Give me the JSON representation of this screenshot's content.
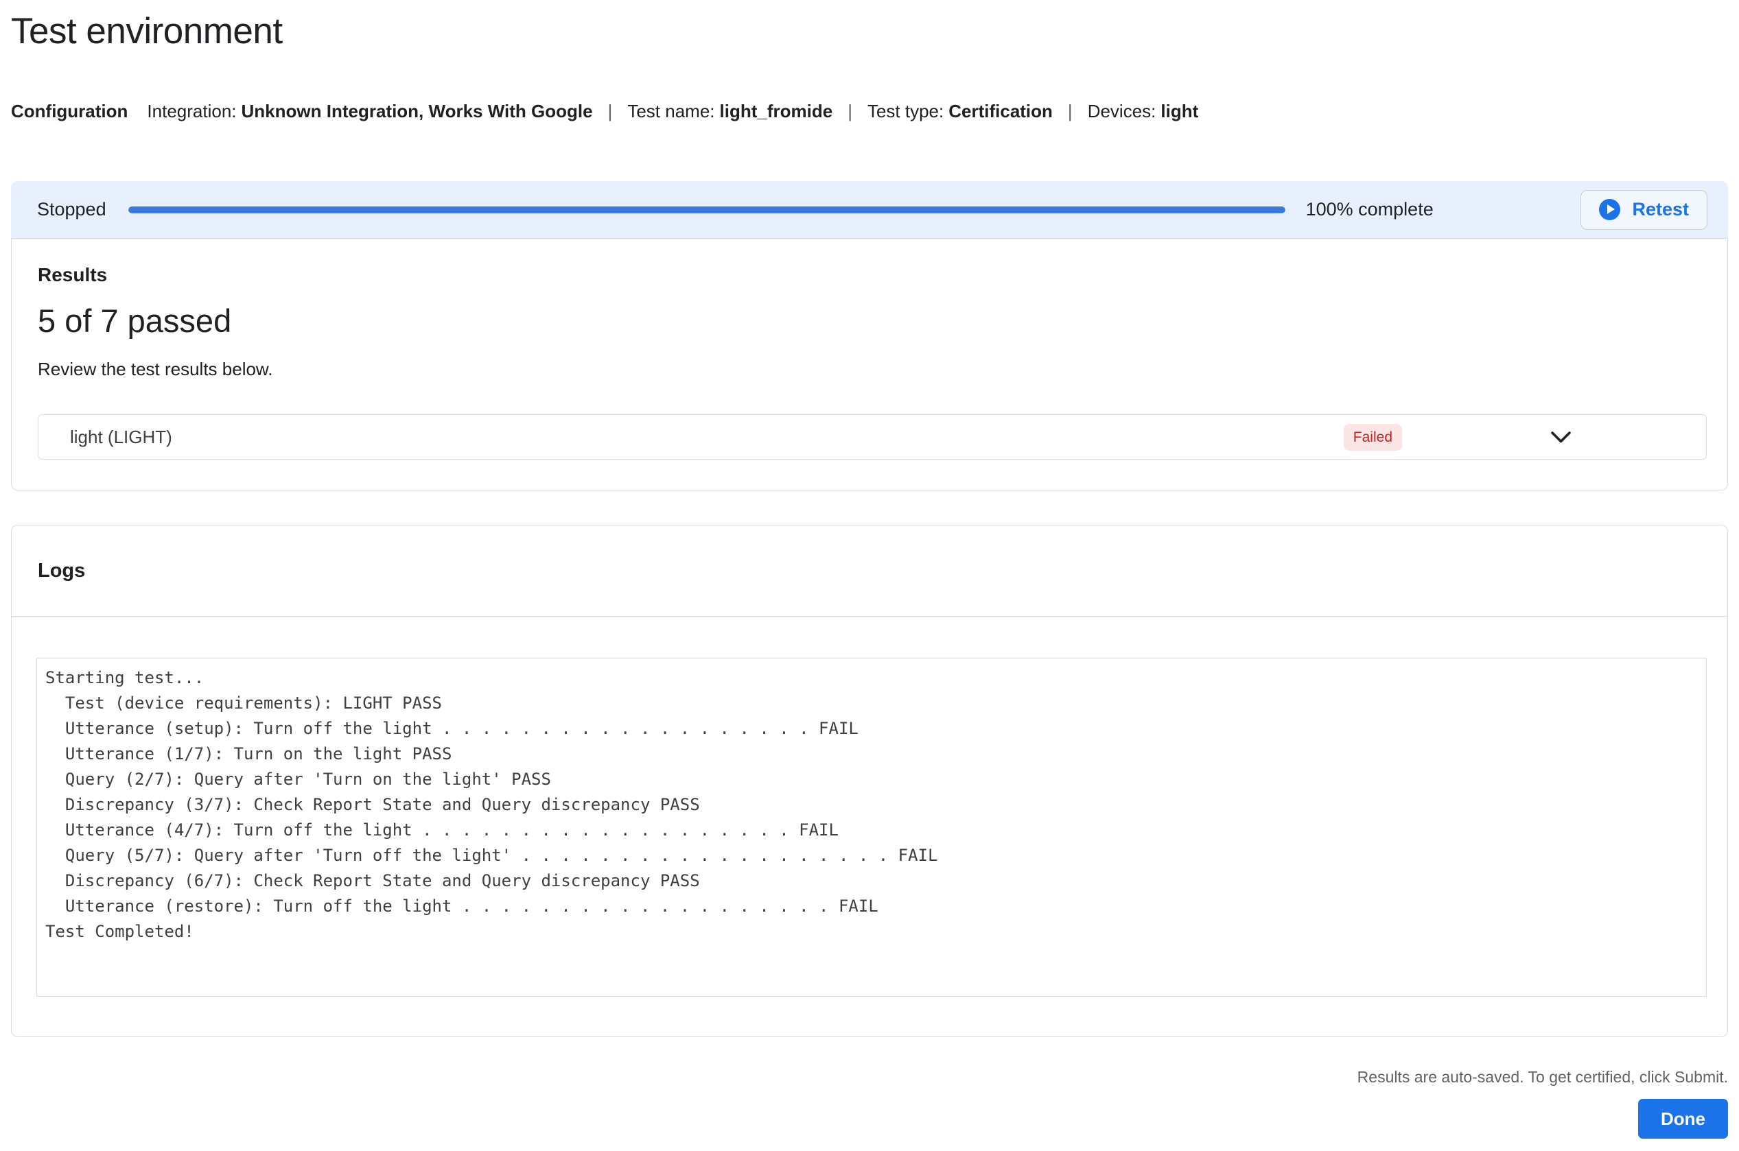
{
  "page": {
    "title": "Test environment"
  },
  "config": {
    "section_label": "Configuration",
    "separator": "|",
    "items": [
      {
        "label": "Integration:",
        "value": "Unknown Integration, Works With Google"
      },
      {
        "label": "Test name:",
        "value": "light_fromide"
      },
      {
        "label": "Test type:",
        "value": "Certification"
      },
      {
        "label": "Devices:",
        "value": "light"
      }
    ]
  },
  "progress": {
    "status": "Stopped",
    "percent": 100,
    "percent_label": "100% complete",
    "retest_label": "Retest"
  },
  "results": {
    "section_label": "Results",
    "summary": "5 of 7 passed",
    "description": "Review the test results below.",
    "rows": [
      {
        "name": "light (LIGHT)",
        "status": "Failed"
      }
    ]
  },
  "logs": {
    "section_label": "Logs",
    "lines": [
      "Starting test...",
      "  Test (device requirements): LIGHT PASS",
      "  Utterance (setup): Turn off the light . . . . . . . . . . . . . . . . . . . FAIL",
      "  Utterance (1/7): Turn on the light PASS",
      "  Query (2/7): Query after 'Turn on the light' PASS",
      "  Discrepancy (3/7): Check Report State and Query discrepancy PASS",
      "  Utterance (4/7): Turn off the light . . . . . . . . . . . . . . . . . . . FAIL",
      "  Query (5/7): Query after 'Turn off the light' . . . . . . . . . . . . . . . . . . . FAIL",
      "  Discrepancy (6/7): Check Report State and Query discrepancy PASS",
      "  Utterance (restore): Turn off the light . . . . . . . . . . . . . . . . . . . FAIL",
      "Test Completed!"
    ]
  },
  "footer": {
    "note": "Results are auto-saved. To get certified, click Submit.",
    "done_label": "Done"
  },
  "colors": {
    "accent": "#1A73E8",
    "banner_bg": "#E8F0FE",
    "progress_bar": "#3B78E0",
    "border": "#DADCE0",
    "failed_bg": "#F9E5E3",
    "failed_text": "#C5221F",
    "muted_text": "#5F6368"
  }
}
